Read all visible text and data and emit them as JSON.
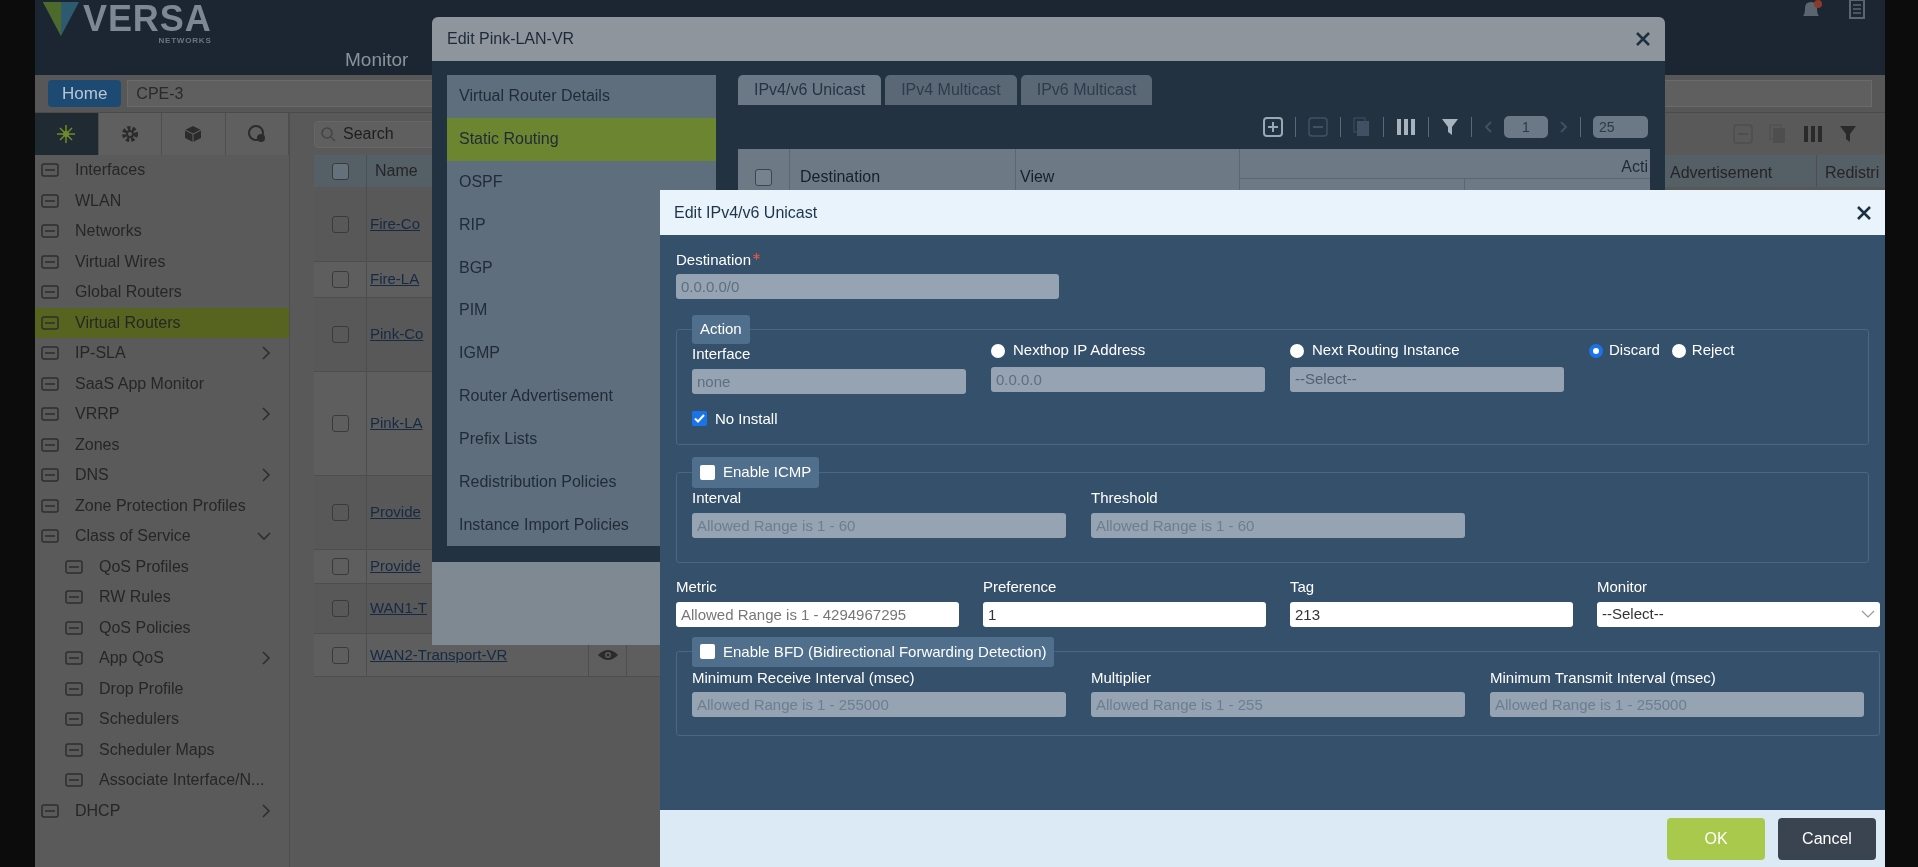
{
  "app": {
    "logo": "VERSA",
    "logo_sub": "NETWORKS",
    "nav": "Monitor"
  },
  "breadcrumb": {
    "home": "Home",
    "device": "CPE-3"
  },
  "sidebar_tabs": [
    {
      "selected": true
    },
    {
      "selected": false
    },
    {
      "selected": false
    },
    {
      "selected": false
    }
  ],
  "sidebar_items": [
    {
      "label": "Interfaces",
      "selected": false
    },
    {
      "label": "WLAN",
      "selected": false
    },
    {
      "label": "Networks",
      "selected": false
    },
    {
      "label": "Virtual Wires",
      "selected": false
    },
    {
      "label": "Global Routers",
      "selected": false
    },
    {
      "label": "Virtual Routers",
      "selected": true
    },
    {
      "label": "IP-SLA",
      "selected": false,
      "expanded": false
    },
    {
      "label": "SaaS App Monitor",
      "selected": false
    },
    {
      "label": "VRRP",
      "selected": false,
      "expanded": false
    },
    {
      "label": "Zones",
      "selected": false
    },
    {
      "label": "DNS",
      "selected": false,
      "expanded": false
    },
    {
      "label": "Zone Protection Profiles",
      "selected": false
    },
    {
      "label": "Class of Service",
      "selected": false,
      "expanded": true,
      "children": [
        {
          "label": "QoS Profiles",
          "selected": false
        },
        {
          "label": "RW Rules",
          "selected": false
        },
        {
          "label": "QoS Policies",
          "selected": false
        },
        {
          "label": "App QoS",
          "selected": false,
          "expanded": false
        },
        {
          "label": "Drop Profile",
          "selected": false
        },
        {
          "label": "Schedulers",
          "selected": false
        },
        {
          "label": "Scheduler Maps",
          "selected": false
        },
        {
          "label": "Associate Interface/N...",
          "selected": false
        }
      ]
    },
    {
      "label": "DHCP",
      "selected": false,
      "expanded": false
    }
  ],
  "main_table": {
    "search_placeholder": "Search",
    "all_checked": false,
    "columns": [
      "Name",
      "Advertisement",
      "Redistri"
    ],
    "rows": [
      {
        "name": "Fire-Co",
        "checked": false
      },
      {
        "name": "Fire-LA",
        "checked": false
      },
      {
        "name": "Pink-Co",
        "checked": false
      },
      {
        "name": "Pink-LA",
        "checked": false
      },
      {
        "name": "Provide",
        "checked": false
      },
      {
        "name": "Provide",
        "checked": false
      },
      {
        "name": "WAN1-T",
        "checked": false
      },
      {
        "name": "WAN2-Transport-VR",
        "checked": false
      }
    ]
  },
  "router_dialog": {
    "title": "Edit Pink-LAN-VR",
    "menu": [
      {
        "label": "Virtual Router Details",
        "selected": false
      },
      {
        "label": "Static Routing",
        "selected": true
      },
      {
        "label": "OSPF",
        "selected": false
      },
      {
        "label": "RIP",
        "selected": false
      },
      {
        "label": "BGP",
        "selected": false
      },
      {
        "label": "PIM",
        "selected": false
      },
      {
        "label": "IGMP",
        "selected": false
      },
      {
        "label": "Router Advertisement",
        "selected": false
      },
      {
        "label": "Prefix Lists",
        "selected": false
      },
      {
        "label": "Redistribution Policies",
        "selected": false
      },
      {
        "label": "Instance Import Policies",
        "selected": false
      }
    ],
    "tabs": [
      {
        "label": "IPv4/v6 Unicast",
        "selected": true
      },
      {
        "label": "IPv4 Multicast",
        "selected": false
      },
      {
        "label": "IPv6 Multicast",
        "selected": false
      }
    ],
    "pager": {
      "page": "1",
      "page_size": "25"
    },
    "all_checked": false,
    "columns": [
      "Destination",
      "View",
      "Acti"
    ]
  },
  "unicast_dialog": {
    "title": "Edit IPv4/v6 Unicast",
    "destination": {
      "label": "Destination",
      "required": true,
      "value": "0.0.0.0/0",
      "disabled": true
    },
    "action": {
      "legend": "Action",
      "interface": {
        "label": "Interface",
        "value": "none",
        "disabled": true
      },
      "options": [
        {
          "label": "Nexthop IP Address",
          "selected": false,
          "kind": "input",
          "value": "0.0.0.0"
        },
        {
          "label": "Next Routing Instance",
          "selected": false,
          "kind": "select",
          "value": "--Select--"
        },
        {
          "label": "Discard",
          "selected": true,
          "kind": "plain"
        },
        {
          "label": "Reject",
          "selected": false,
          "kind": "plain"
        }
      ],
      "no_install": {
        "label": "No Install",
        "checked": true
      }
    },
    "icmp": {
      "label": "Enable ICMP",
      "checked": false,
      "fields": [
        {
          "label": "Interval",
          "placeholder": "Allowed Range is 1 - 60"
        },
        {
          "label": "Threshold",
          "placeholder": "Allowed Range is 1 - 60"
        }
      ]
    },
    "fields": [
      {
        "label": "Metric",
        "kind": "input",
        "placeholder": "Allowed Range is 1 - 4294967295"
      },
      {
        "label": "Preference",
        "kind": "input",
        "value": "1"
      },
      {
        "label": "Tag",
        "kind": "input",
        "value": "213"
      },
      {
        "label": "Monitor",
        "kind": "select",
        "value": "--Select--"
      }
    ],
    "bfd": {
      "label": "Enable BFD (Bidirectional Forwarding Detection)",
      "checked": false,
      "fields": [
        {
          "label": "Minimum Receive Interval (msec)",
          "placeholder": "Allowed Range is 1 - 255000"
        },
        {
          "label": "Multiplier",
          "placeholder": "Allowed Range is 1 - 255"
        },
        {
          "label": "Minimum Transmit Interval (msec)",
          "placeholder": "Allowed Range is 1 - 255000"
        }
      ]
    },
    "buttons": [
      {
        "label": "OK",
        "kind": "primary"
      },
      {
        "label": "Cancel",
        "kind": "secondary"
      }
    ]
  }
}
